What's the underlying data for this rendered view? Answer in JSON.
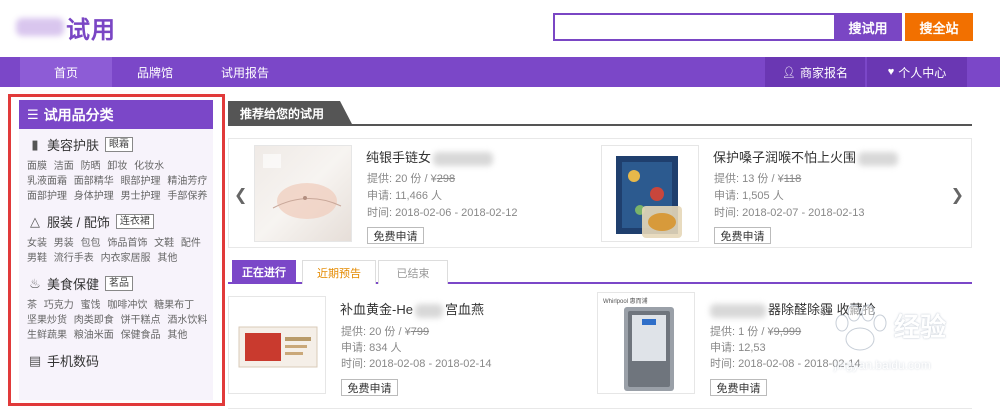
{
  "header": {
    "logo_text": "试用",
    "search_placeholder": "",
    "search_button": "搜试用",
    "search_all_button": "搜全站"
  },
  "nav": {
    "items": [
      "首页",
      "品牌馆",
      "试用报告"
    ],
    "right_items": [
      {
        "label": "商家报名",
        "icon": "user-icon"
      },
      {
        "label": "个人中心",
        "icon": "heart-icon"
      }
    ]
  },
  "sidebar": {
    "title": "试用品分类",
    "categories": [
      {
        "name": "美容护肤",
        "tag": "眼霜",
        "icon": "lipstick-icon",
        "rows": [
          [
            "面膜",
            "洁面",
            "防晒",
            "卸妆",
            "化妆水"
          ],
          [
            "乳液面霜",
            "面部精华",
            "眼部护理",
            "精油芳疗"
          ],
          [
            "面部护理",
            "身体护理",
            "男士护理",
            "手部保养"
          ]
        ]
      },
      {
        "name": "服装 / 配饰",
        "tag": "连衣裙",
        "icon": "shirt-icon",
        "rows": [
          [
            "女装",
            "男装",
            "包包",
            "饰品首饰",
            "文鞋",
            "配件"
          ],
          [
            "男鞋",
            "流行手表",
            "内衣家居服",
            "其他"
          ]
        ]
      },
      {
        "name": "美食保健",
        "tag": "茗品",
        "icon": "food-icon",
        "rows": [
          [
            "茶",
            "巧克力",
            "蜜饯",
            "咖啡冲饮",
            "糖果布丁"
          ],
          [
            "坚果炒货",
            "肉类即食",
            "饼干糕点",
            "酒水饮料"
          ],
          [
            "生鲜蔬果",
            "粮油米面",
            "保健食品",
            "其他"
          ]
        ]
      },
      {
        "name": "手机数码",
        "tag": "",
        "icon": "laptop-icon",
        "rows": []
      }
    ]
  },
  "recommend": {
    "title": "推荐给您的试用",
    "products": [
      {
        "name": "纯银手链女",
        "supply_label": "提供:",
        "supply": "20 份 / ¥",
        "price": "298",
        "apply_label": "申请:",
        "applicants": "11,466 人",
        "time_label": "时间:",
        "time": "2018-02-06 - 2018-02-12",
        "button": "免费申请"
      },
      {
        "name": "保护嗓子润喉不怕上火围",
        "supply_label": "提供:",
        "supply": "13 份 / ¥",
        "price": "118",
        "apply_label": "申请:",
        "applicants": "1,505 人",
        "time_label": "时间:",
        "time": "2018-02-07 - 2018-02-13",
        "button": "免费申请"
      }
    ]
  },
  "status_tabs": [
    "正在进行",
    "近期预告",
    "已结束"
  ],
  "list": {
    "products": [
      {
        "name": "补血黄金-He",
        "name_tail": "宫血燕",
        "supply_label": "提供:",
        "supply": "20 份 / ¥",
        "price": "799",
        "apply_label": "申请:",
        "applicants": "834 人",
        "time_label": "时间:",
        "time": "2018-02-08 - 2018-02-14",
        "button": "免费申请"
      },
      {
        "name": "器除醛除霾 收藏抢",
        "supply_label": "提供:",
        "supply": "1 份 / ¥",
        "price": "9,999",
        "apply_label": "申请:",
        "applicants": "12,53",
        "time_label": "时间:",
        "time": "2018-02-08 - 2018-02-14",
        "button": "免费申请",
        "brand_mark": "Whirlpool 惠而浦"
      }
    ]
  },
  "watermark": {
    "text": "经验",
    "url": "jingyan.baidu.com"
  },
  "colors": {
    "brand_purple": "#7b47c8",
    "orange": "#f27000",
    "outline_red": "#e13a3a"
  }
}
